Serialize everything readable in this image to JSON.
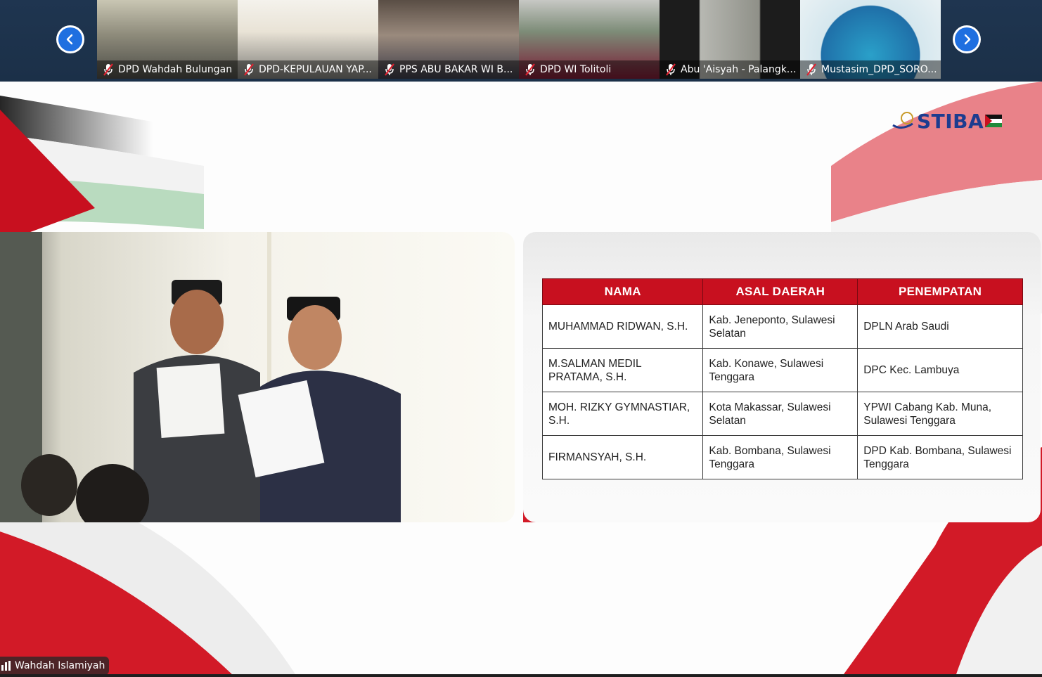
{
  "participants": [
    {
      "name": "DPD Wahdah Bulungan"
    },
    {
      "name": "DPD-KEPULAUAN YAP..."
    },
    {
      "name": "PPS ABU BAKAR WI B..."
    },
    {
      "name": "DPD WI Tolitoli"
    },
    {
      "name": "Abu 'Aisyah - Palangka..."
    },
    {
      "name": "Mustasim_DPD_SORO..."
    }
  ],
  "slide": {
    "logo_text": "STIBA",
    "table": {
      "headers": [
        "NAMA",
        "ASAL DAERAH",
        "PENEMPATAN"
      ],
      "rows": [
        [
          "MUHAMMAD RIDWAN, S.H.",
          "Kab. Jeneponto, Sulawesi Selatan",
          "DPLN Arab Saudi"
        ],
        [
          "M.SALMAN MEDIL PRATAMA, S.H.",
          "Kab. Konawe, Sulawesi Tenggara",
          "DPC Kec. Lambuya"
        ],
        [
          "MOH. RIZKY GYMNASTIAR, S.H.",
          "Kota Makassar, Sulawesi Selatan",
          "YPWI Cabang Kab. Muna, Sulawesi Tenggara"
        ],
        [
          "FIRMANSYAH, S.H.",
          "Kab. Bombana, Sulawesi Tenggara",
          "DPD Kab. Bombana, Sulawesi Tenggara"
        ]
      ]
    }
  },
  "active_speaker": {
    "name": "Wahdah Islamiyah"
  },
  "colors": {
    "accent_blue": "#1f6fe0",
    "flag_red": "#c8101f",
    "strip_bg": "#1f3550"
  },
  "icons": {
    "prev": "chevron-left-icon",
    "next": "chevron-right-icon",
    "muted": "mic-off-icon",
    "audio": "audio-bars-icon"
  }
}
